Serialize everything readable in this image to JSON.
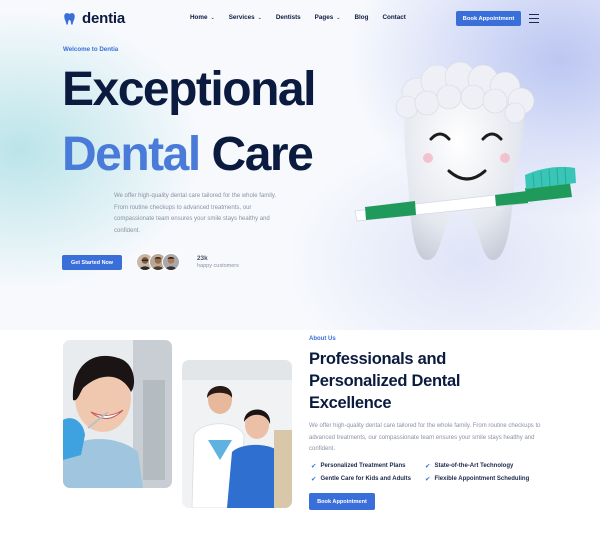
{
  "brand": {
    "name": "dentia",
    "accent": "#3a6fd9"
  },
  "nav": {
    "items": [
      {
        "label": "Home",
        "has_dropdown": true
      },
      {
        "label": "Services",
        "has_dropdown": true
      },
      {
        "label": "Dentists",
        "has_dropdown": false
      },
      {
        "label": "Pages",
        "has_dropdown": true
      },
      {
        "label": "Blog",
        "has_dropdown": false
      },
      {
        "label": "Contact",
        "has_dropdown": false
      }
    ],
    "book_button": "Book Appointment",
    "menu_icon": "hamburger-icon"
  },
  "hero": {
    "eyebrow": "Welcome to Dentia",
    "title_line1": "Exceptional",
    "title_line2_accent": "Dental",
    "title_line2_rest": "Care",
    "description": "We offer high-quality dental care tailored for the whole family. From routine checkups to advanced treatments, our compassionate team ensures your smile stays healthy and confident.",
    "cta_label": "Get Started Now",
    "happy_count": "23k",
    "happy_label": "happy customers"
  },
  "about": {
    "eyebrow": "About Us",
    "title_line1": "Professionals and",
    "title_line2": "Personalized Dental",
    "title_line3": "Excellence",
    "description": "We offer high-quality dental care tailored for the whole family. From routine checkups to advanced treatments, our compassionate team ensures your smile stays healthy and confident.",
    "features": [
      "Personalized Treatment Plans",
      "State-of-the-Art Technology",
      "Gentle Care for Kids and Adults",
      "Flexible Appointment Scheduling"
    ],
    "cta_label": "Book Appointment"
  }
}
